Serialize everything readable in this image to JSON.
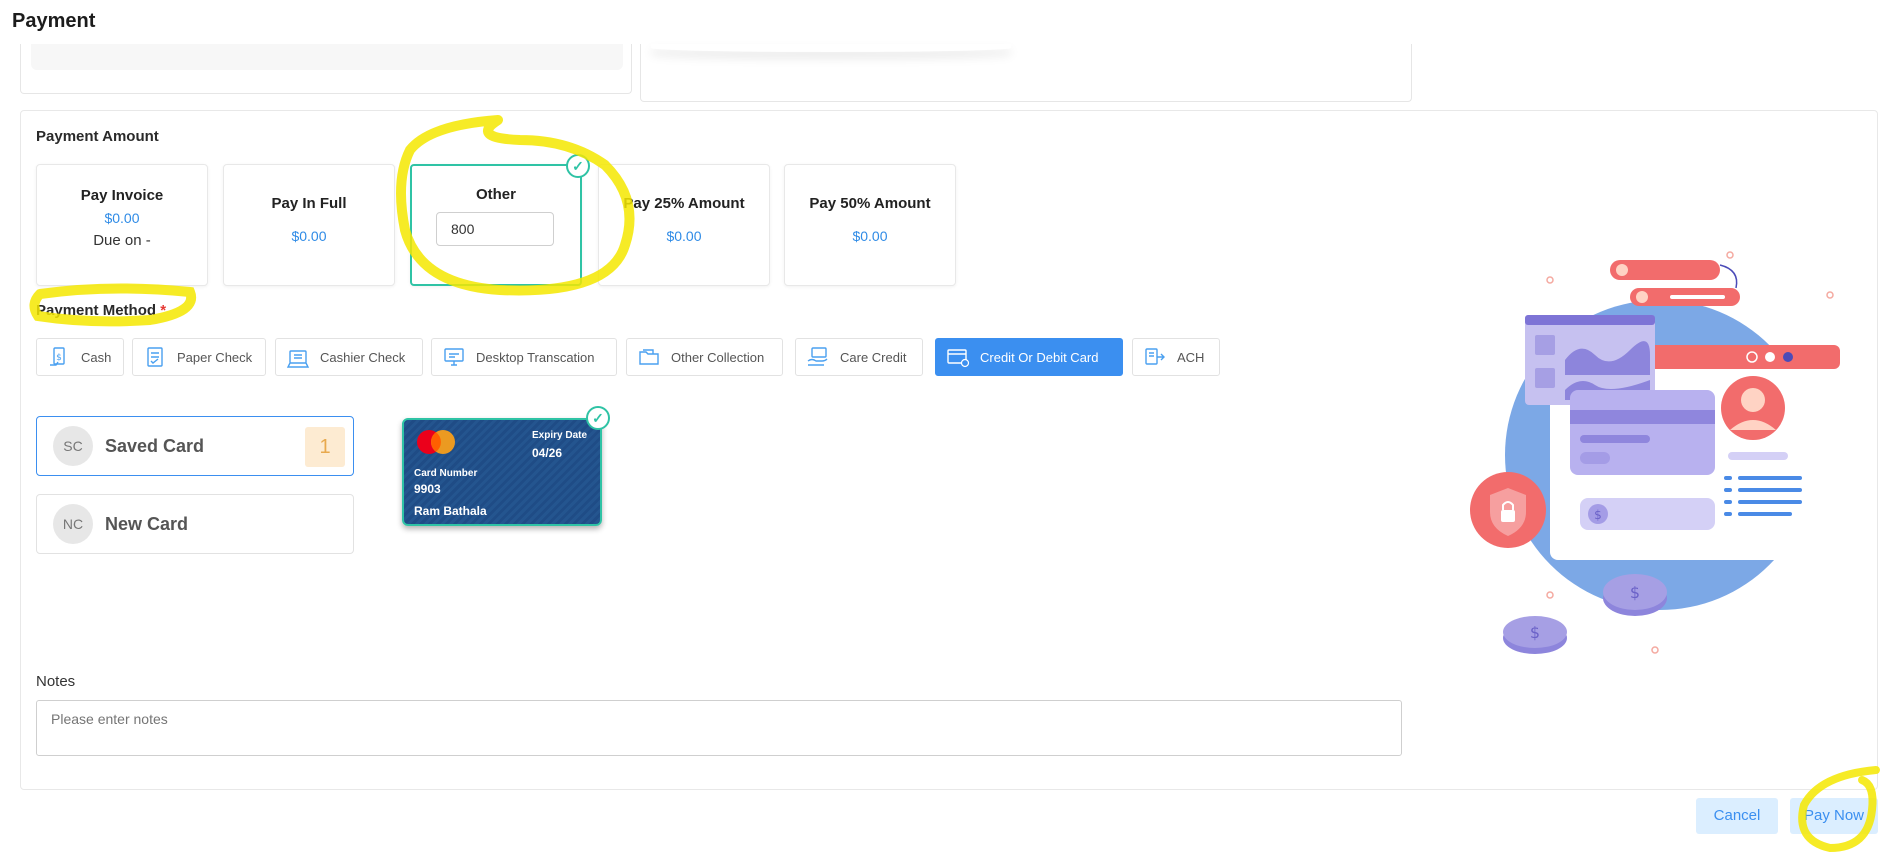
{
  "page": {
    "title": "Payment"
  },
  "payment_amount": {
    "label": "Payment Amount",
    "options": [
      {
        "title": "Pay Invoice",
        "value": "$0.00",
        "due": "Due on -"
      },
      {
        "title": "Pay In Full",
        "value": "$0.00"
      },
      {
        "title": "Other",
        "input_value": "800",
        "selected": true
      },
      {
        "title": "Pay 25% Amount",
        "value": "$0.00"
      },
      {
        "title": "Pay 50% Amount",
        "value": "$0.00"
      }
    ]
  },
  "payment_method": {
    "label": "Payment Method",
    "required_mark": "*",
    "tabs": [
      {
        "label": "Cash",
        "icon": "cash-icon"
      },
      {
        "label": "Paper Check",
        "icon": "paper-check-icon"
      },
      {
        "label": "Cashier Check",
        "icon": "cashier-check-icon"
      },
      {
        "label": "Desktop Transcation",
        "icon": "desktop-icon"
      },
      {
        "label": "Other Collection",
        "icon": "folder-icon"
      },
      {
        "label": "Care Credit",
        "icon": "care-credit-icon"
      },
      {
        "label": "Credit Or Debit Card",
        "icon": "credit-card-icon",
        "active": true
      },
      {
        "label": "ACH",
        "icon": "bank-icon"
      }
    ]
  },
  "cards": {
    "saved": {
      "initials": "SC",
      "label": "Saved Card",
      "count": "1"
    },
    "new": {
      "initials": "NC",
      "label": "New Card"
    },
    "selected_card": {
      "expiry_label": "Expiry Date",
      "expiry": "04/26",
      "number_label": "Card Number",
      "number": "9903",
      "holder": "Ram Bathala"
    }
  },
  "notes": {
    "label": "Notes",
    "placeholder": "Please enter notes"
  },
  "actions": {
    "cancel": "Cancel",
    "pay_now": "Pay Now"
  },
  "colors": {
    "accent": "#3b8ff0",
    "selected": "#2fc3a5",
    "highlight": "#f5e800"
  }
}
